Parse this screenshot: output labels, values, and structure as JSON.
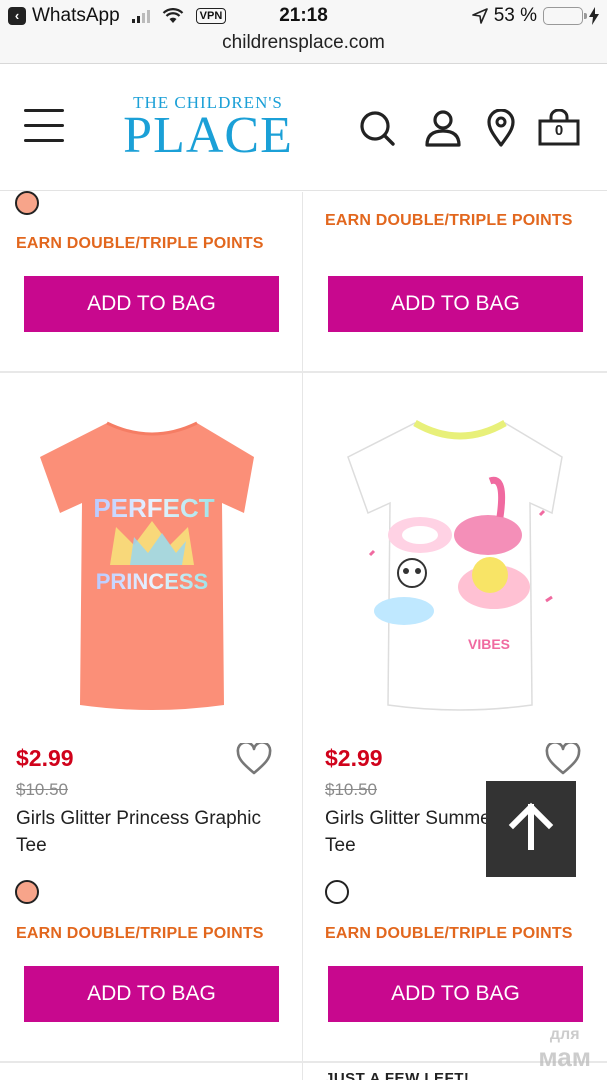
{
  "status_bar": {
    "back_app": "WhatsApp",
    "vpn": "VPN",
    "time": "21:18",
    "battery": "53 %",
    "battery_level": 0.53
  },
  "browser": {
    "url": "childrensplace.com"
  },
  "header": {
    "logo_line1": "THE CHILDREN'S",
    "logo_line2": "PLACE",
    "bag_count": "0"
  },
  "top_row": [
    {
      "promo": "EARN DOUBLE/TRIPLE POINTS",
      "add_label": "ADD TO BAG",
      "swatch_color": "#f7a48a"
    },
    {
      "promo": "EARN DOUBLE/TRIPLE POINTS",
      "add_label": "ADD TO BAG"
    }
  ],
  "products": [
    {
      "price": "$2.99",
      "original_price": "$10.50",
      "name": "Girls Glitter Princess Graphic Tee",
      "swatch_color": "#f7a48a",
      "promo": "EARN DOUBLE/TRIPLE POINTS",
      "add_label": "ADD TO BAG",
      "graphic_line1": "PERFECT",
      "graphic_line2": "PRINCESS"
    },
    {
      "price": "$2.99",
      "original_price": "$10.50",
      "name": "Girls Glitter Summer Graphic Tee",
      "swatch_color": "#ffffff",
      "promo": "EARN DOUBLE/TRIPLE POINTS",
      "add_label": "ADD TO BAG",
      "graphic_word": "VIBES"
    }
  ],
  "partial_label": "JUST A FEW LEFT!",
  "watermark": {
    "line1": "для",
    "line2": "мам"
  },
  "colors": {
    "brand_blue": "#1ba0d7",
    "button_magenta": "#c8088e",
    "promo_orange": "#e2671e",
    "sale_red": "#d0021b"
  }
}
